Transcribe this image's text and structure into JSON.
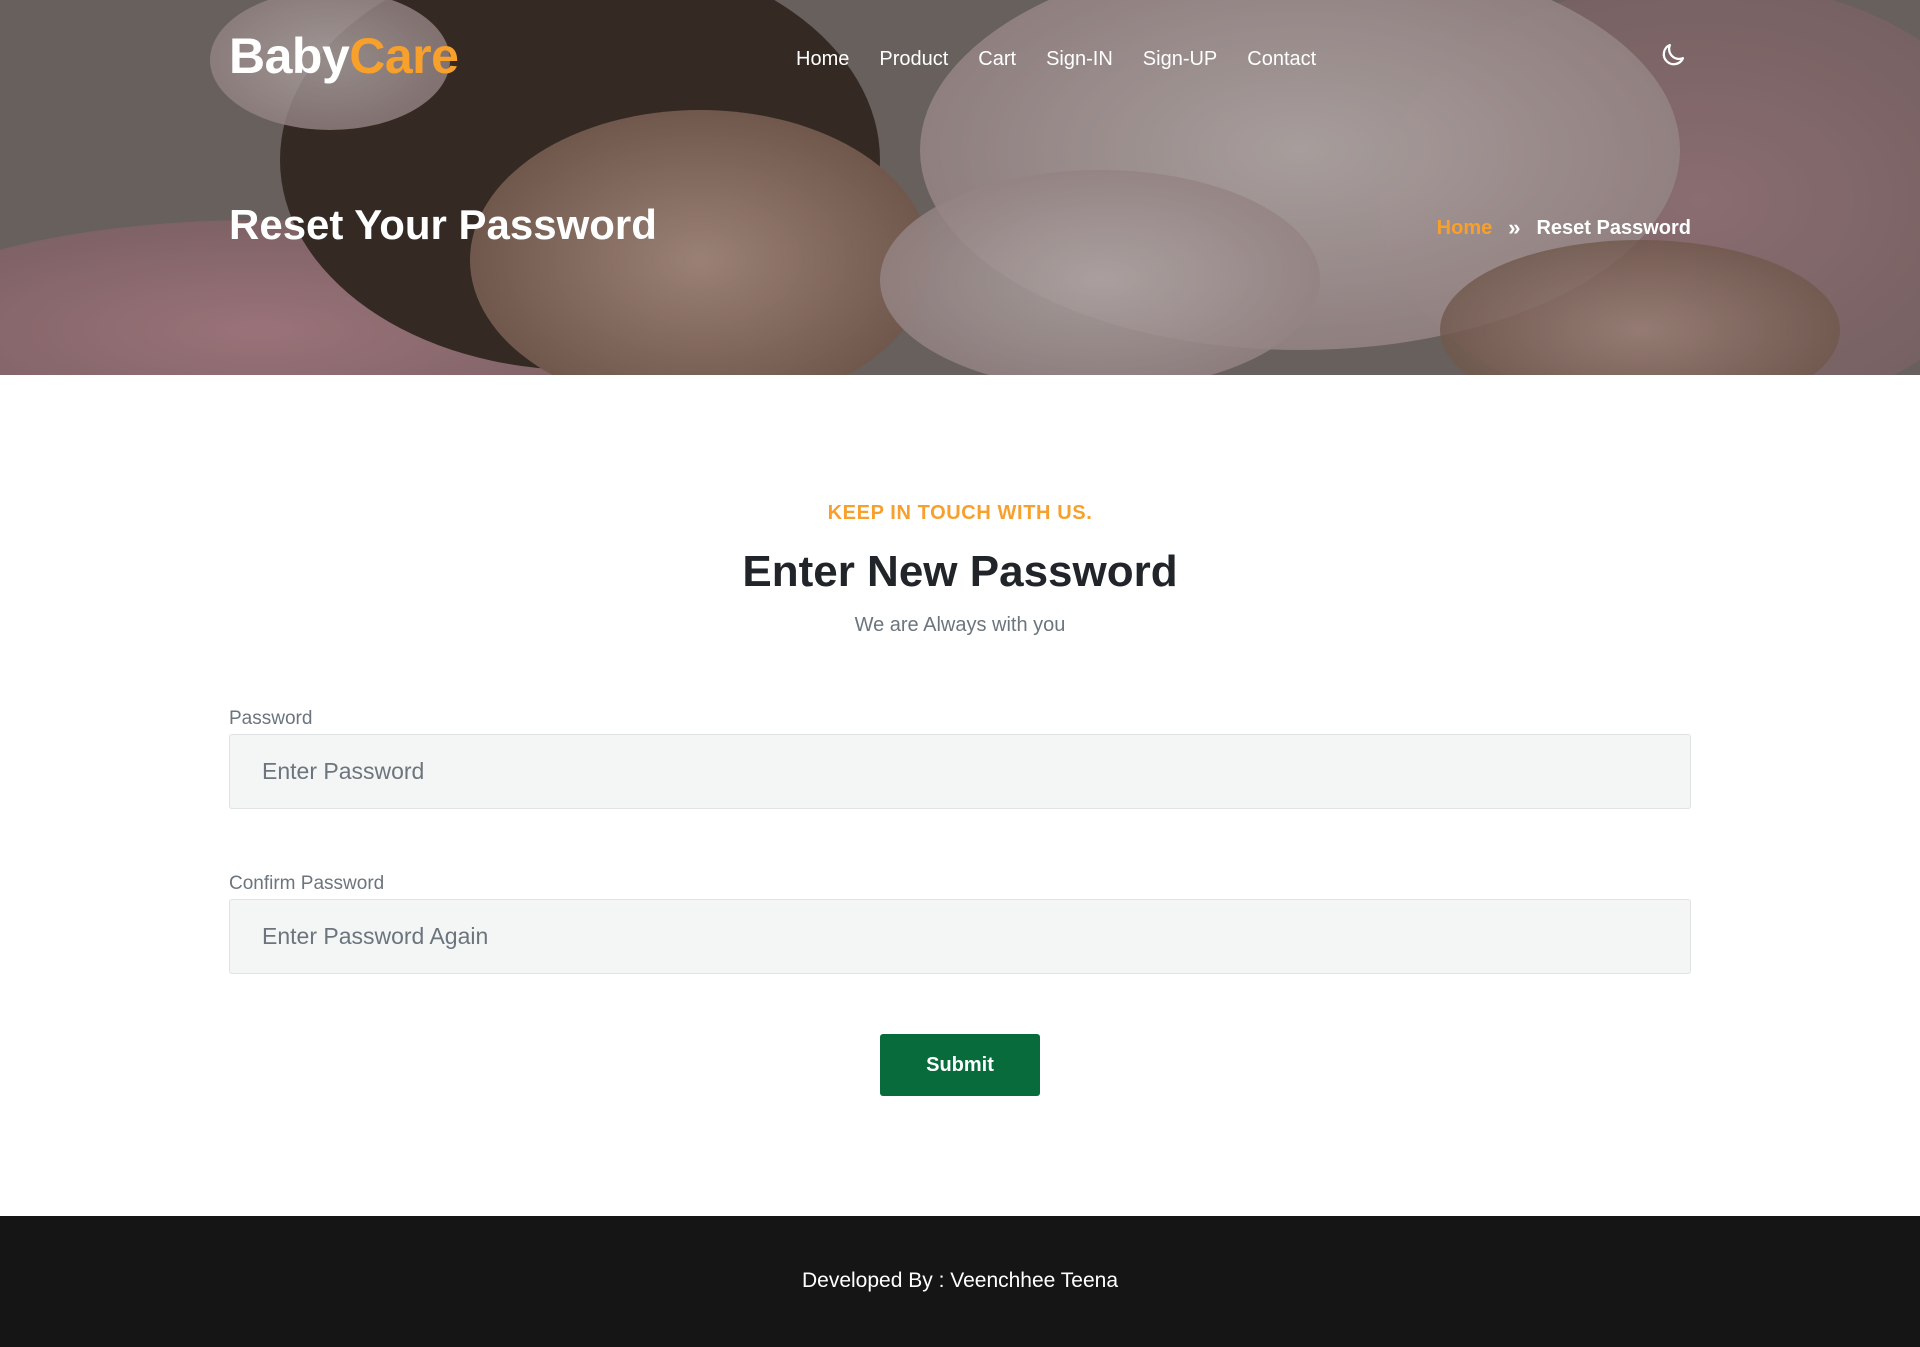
{
  "brand": {
    "part1": "Baby",
    "part2": "Care"
  },
  "nav": {
    "items": [
      "Home",
      "Product",
      "Cart",
      "Sign-IN",
      "Sign-UP",
      "Contact"
    ]
  },
  "theme_toggle": {
    "icon": "moon-icon"
  },
  "hero": {
    "title": "Reset Your Password",
    "breadcrumb": {
      "home": "Home",
      "separator": "»",
      "current": "Reset Password"
    }
  },
  "section": {
    "tag": "KEEP IN TOUCH WITH US.",
    "title": "Enter New Password",
    "subtitle": "We are Always with you"
  },
  "form": {
    "password": {
      "label": "Password",
      "placeholder": "Enter Password",
      "value": ""
    },
    "confirm": {
      "label": "Confirm Password",
      "placeholder": "Enter Password Again",
      "value": ""
    },
    "submit_label": "Submit"
  },
  "footer": {
    "text": "Developed By : Veenchhee Teena"
  },
  "colors": {
    "accent": "#f7a02c",
    "button": "#076b3c",
    "footer_bg": "#151515",
    "heading": "#212529",
    "muted": "#6c757d"
  }
}
